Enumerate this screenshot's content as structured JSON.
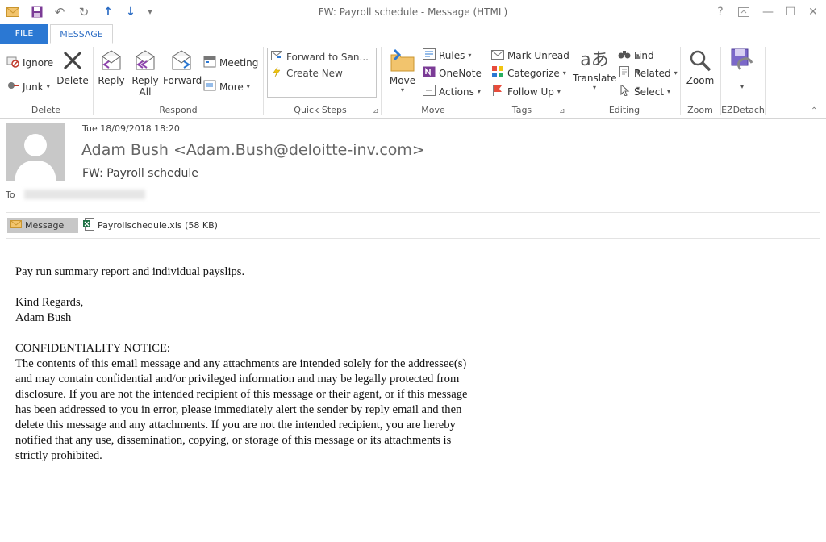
{
  "window": {
    "title": "FW: Payroll schedule  - Message (HTML)",
    "help": "?",
    "minimize": "—",
    "maximize": "☐",
    "close": "✕"
  },
  "tabs": {
    "file": "FILE",
    "message": "MESSAGE"
  },
  "ribbon": {
    "delete_group": {
      "label": "Delete",
      "ignore": "Ignore",
      "junk": "Junk",
      "delete": "Delete"
    },
    "respond_group": {
      "label": "Respond",
      "reply": "Reply",
      "reply_all_1": "Reply",
      "reply_all_2": "All",
      "forward": "Forward",
      "meeting": "Meeting",
      "more": "More"
    },
    "quick_steps": {
      "label": "Quick Steps",
      "items": [
        "Forward to San...",
        "Create New"
      ]
    },
    "move_group": {
      "label": "Move",
      "move": "Move",
      "rules": "Rules",
      "onenote": "OneNote",
      "actions": "Actions"
    },
    "tags_group": {
      "label": "Tags",
      "mark_unread": "Mark Unread",
      "categorize": "Categorize",
      "follow_up": "Follow Up"
    },
    "editing_group": {
      "label": "Editing",
      "translate": "Translate",
      "find": "Find",
      "related": "Related",
      "select": "Select"
    },
    "zoom_group": {
      "label": "Zoom",
      "zoom": "Zoom"
    },
    "ezdetach_group": {
      "label": "EZDetach"
    }
  },
  "message": {
    "date": "Tue 18/09/2018 18:20",
    "from": "Adam Bush <Adam.Bush@deloitte-inv.com>",
    "subject": "FW: Payroll schedule",
    "to_label": "To",
    "attachments": {
      "message_tab": "Message",
      "file": "Payrollschedule.xls (58 KB)"
    },
    "body": {
      "line1": "Pay run summary report and individual payslips.",
      "regards": "Kind Regards,",
      "signature": "Adam Bush",
      "notice_title": "CONFIDENTIALITY NOTICE:",
      "notice_lines": [
        "The contents of this email message and any attachments are intended solely for the addressee(s)",
        "and may contain confidential and/or privileged information and may be legally protected from",
        "disclosure. If you are not the intended recipient of this message or their agent, or if this message",
        "has been addressed to you in error, please immediately alert the sender by reply email and then",
        "delete this message and any attachments. If you are not the intended recipient, you are hereby",
        "notified that any use, dissemination, copying, or storage of this message or its attachments is",
        "strictly prohibited."
      ]
    }
  },
  "colors": {
    "accent": "#2b78d3",
    "file_tab_text": "#ffffff",
    "message_tab_text": "#2b6cc4"
  }
}
